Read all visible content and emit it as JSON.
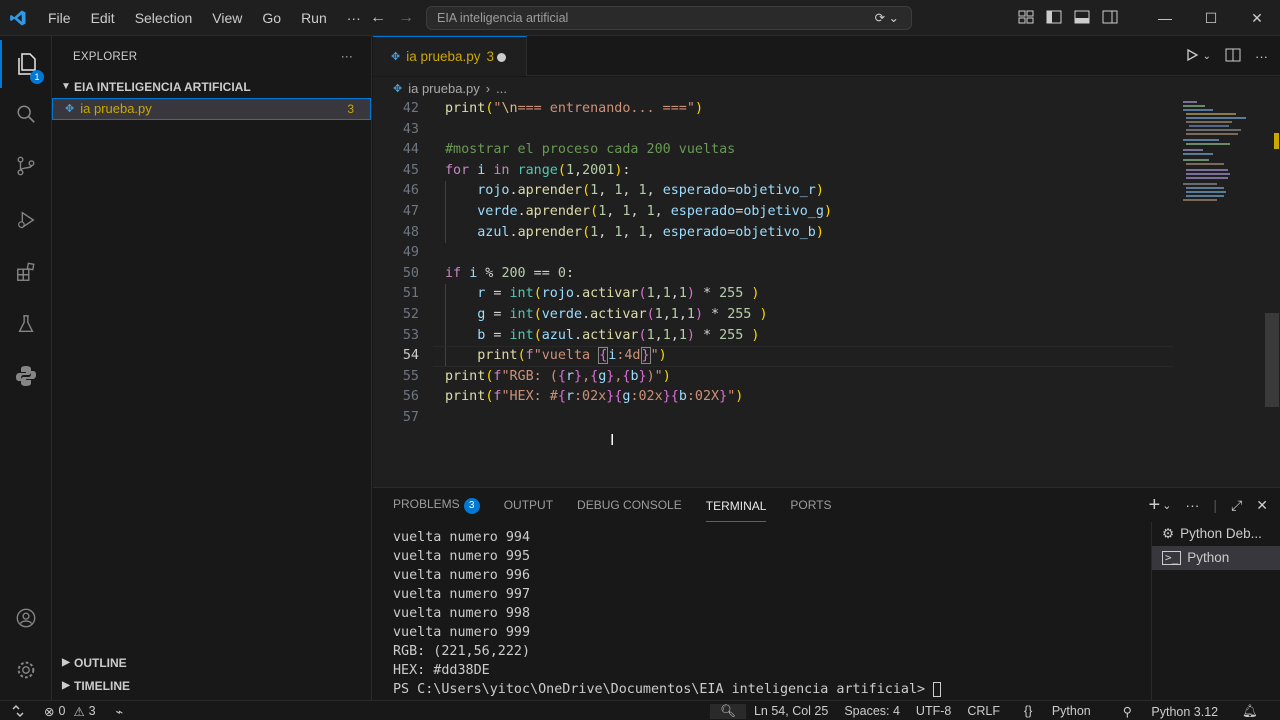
{
  "titlebar": {
    "menu": [
      "File",
      "Edit",
      "Selection",
      "View",
      "Go",
      "Run",
      "···"
    ],
    "search": "EIA inteligencia artificial"
  },
  "activity": {
    "explorer_badge": "1"
  },
  "sidebar": {
    "title": "EXPLORER",
    "folder": "EIA INTELIGENCIA ARTIFICIAL",
    "file": "ia prueba.py",
    "file_problems": "3",
    "outline": "OUTLINE",
    "timeline": "TIMELINE"
  },
  "tab": {
    "label": "ia prueba.py",
    "problems": "3"
  },
  "breadcrumb": {
    "file": "ia prueba.py",
    "rest": "..."
  },
  "editor": {
    "current_line": 54,
    "lines": [
      {
        "n": "42",
        "text": "print(\"\\n=== entrenando... ===\")"
      },
      {
        "n": "43",
        "text": ""
      },
      {
        "n": "44",
        "text": "#mostrar el proceso cada 200 vueltas"
      },
      {
        "n": "45",
        "text": "for i in range(1,2001):"
      },
      {
        "n": "46",
        "text": "    rojo.aprender(1, 1, 1, esperado=objetivo_r)"
      },
      {
        "n": "47",
        "text": "    verde.aprender(1, 1, 1, esperado=objetivo_g)"
      },
      {
        "n": "48",
        "text": "    azul.aprender(1, 1, 1, esperado=objetivo_b)"
      },
      {
        "n": "49",
        "text": ""
      },
      {
        "n": "50",
        "text": "if i % 200 == 0:"
      },
      {
        "n": "51",
        "text": "    r = int(rojo.activar(1,1,1) * 255 )"
      },
      {
        "n": "52",
        "text": "    g = int(verde.activar(1,1,1) * 255 )"
      },
      {
        "n": "53",
        "text": "    b = int(azul.activar(1,1,1) * 255 )"
      },
      {
        "n": "54",
        "text": "    print(f\"vuelta {i:4d}\")"
      },
      {
        "n": "55",
        "text": "print(f\"RGB: ({r},{g},{b})\")"
      },
      {
        "n": "56",
        "text": "print(f\"HEX: #{r:02x}{g:02x}{b:02X}\")"
      },
      {
        "n": "57",
        "text": ""
      }
    ]
  },
  "panel": {
    "tabs": [
      "PROBLEMS",
      "OUTPUT",
      "DEBUG CONSOLE",
      "TERMINAL",
      "PORTS"
    ],
    "problems_count": "3",
    "active_tab": "TERMINAL",
    "terminal_lines": [
      "vuelta numero 994",
      "vuelta numero 995",
      "vuelta numero 996",
      "vuelta numero 997",
      "vuelta numero 998",
      "vuelta numero 999",
      "RGB: (221,56,222)",
      "HEX: #dd38DE",
      "PS C:\\Users\\yitoc\\OneDrive\\Documentos\\EIA inteligencia artificial> "
    ],
    "terminals": [
      "Python Deb...",
      "Python"
    ]
  },
  "statusbar": {
    "errors": "0",
    "warnings": "3",
    "position": "Ln 54, Col 25",
    "spaces": "Spaces: 4",
    "encoding": "UTF-8",
    "eol": "CRLF",
    "language": "Python",
    "interpreter": "Python 3.12"
  },
  "colors": {
    "accent": "#0078d4",
    "warning": "#cca700",
    "bg": "#1f1f1f"
  }
}
